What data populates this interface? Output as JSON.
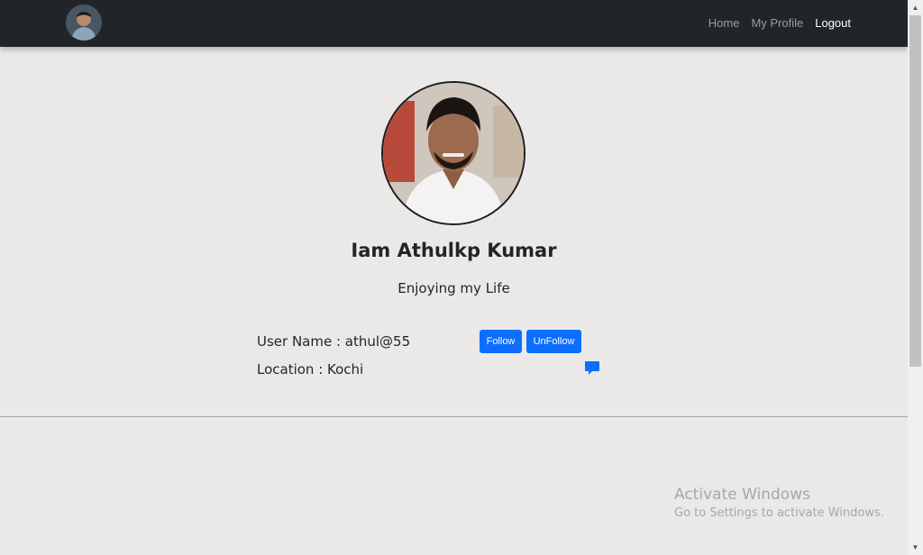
{
  "navbar": {
    "links": [
      {
        "label": "Home"
      },
      {
        "label": "My Profile"
      },
      {
        "label": "Logout"
      }
    ]
  },
  "profile": {
    "name": "Iam Athulkp Kumar",
    "bio": "Enjoying my Life",
    "username_line": "User Name : athul@55",
    "location_line": "Location : Kochi"
  },
  "actions": {
    "follow_label": "Follow",
    "unfollow_label": "UnFollow"
  },
  "icons": {
    "chat": "chat-bubble-icon"
  },
  "watermark": {
    "title": "Activate Windows",
    "subtitle": "Go to Settings to activate Windows."
  },
  "colors": {
    "navbar": "#212529",
    "background": "#ebe9e7",
    "primary": "#0d6efd"
  }
}
